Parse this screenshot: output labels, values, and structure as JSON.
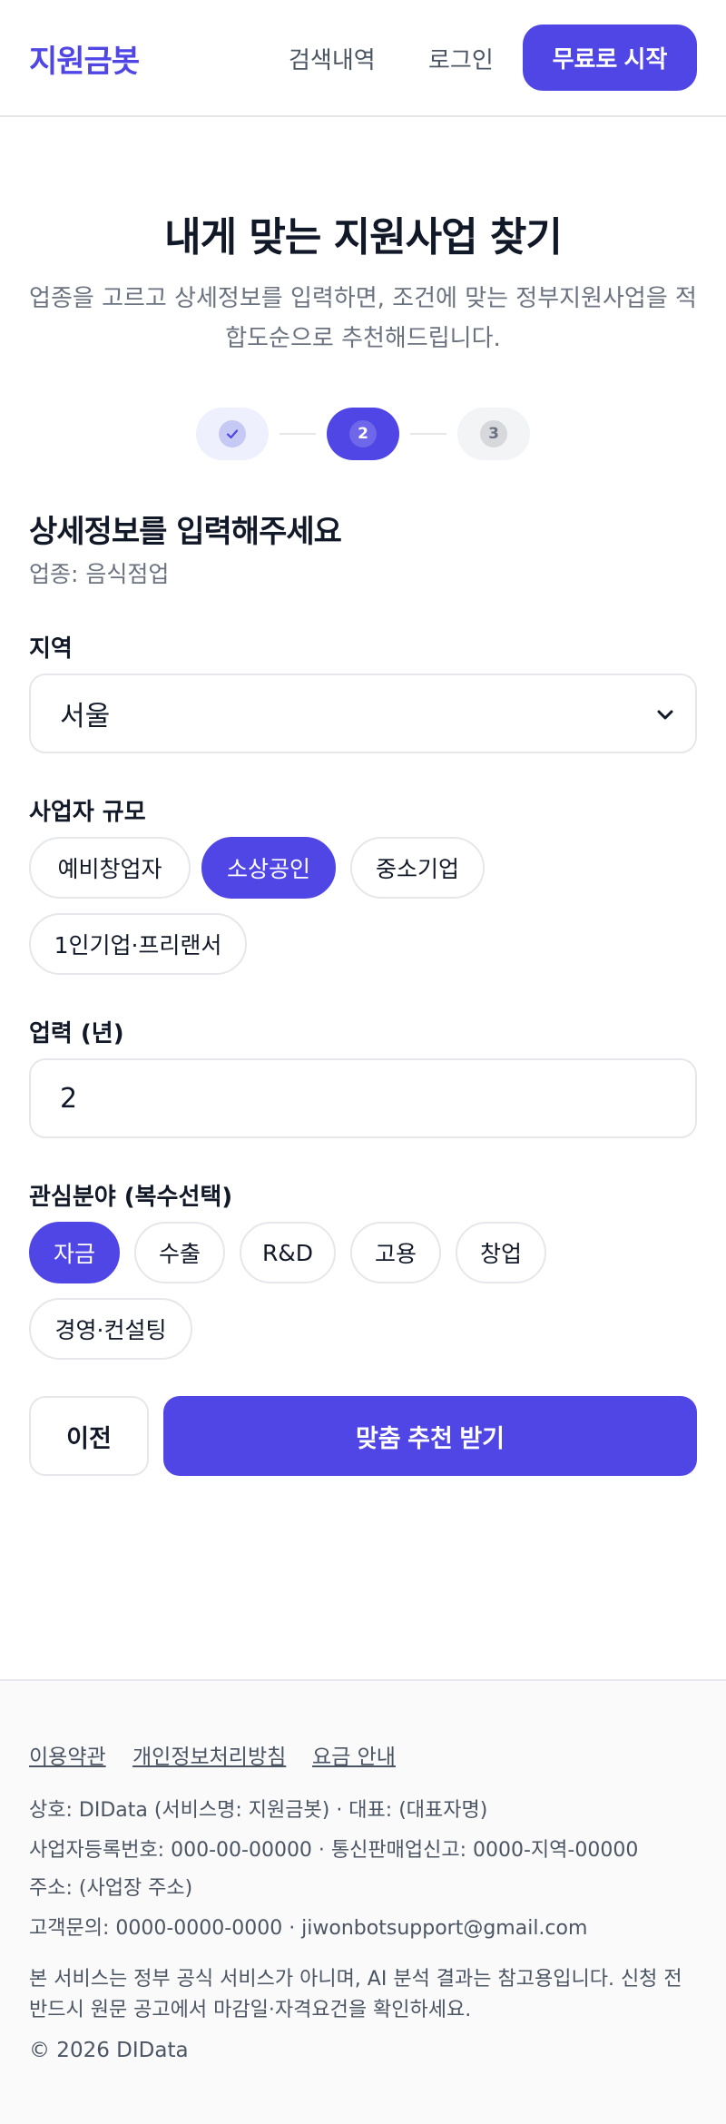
{
  "header": {
    "logo": "지원금봇",
    "nav_history": "검색내역",
    "nav_login": "로그인",
    "cta": "무료로 시작"
  },
  "hero": {
    "title": "내게 맞는 지원사업 찾기",
    "subtitle": "업종을 고르고 상세정보를 입력하면, 조건에 맞는 정부지원사업을 적합도순으로 추천해드립니다."
  },
  "stepper": {
    "current_step": 2,
    "steps": [
      {
        "label": "check-icon",
        "state": "done"
      },
      {
        "label": "2",
        "state": "active"
      },
      {
        "label": "3",
        "state": "pending"
      }
    ]
  },
  "form": {
    "title": "상세정보를 입력해주세요",
    "industry": "업종: 음식점업",
    "region_label": "지역",
    "region_value": "서울",
    "scale_label": "사업자 규모",
    "scale_options": [
      "예비창업자",
      "소상공인",
      "중소기업",
      "1인기업·프리랜서"
    ],
    "scale_selected": "소상공인",
    "years_label": "업력 (년)",
    "years_value": "2",
    "interest_label": "관심분야 (복수선택)",
    "interest_options": [
      "자금",
      "수출",
      "R&D",
      "고용",
      "창업",
      "경영·컨설팅"
    ],
    "interest_selected": [
      "자금"
    ],
    "prev_button": "이전",
    "submit_button": "맞춤 추천 받기"
  },
  "footer": {
    "links": [
      "이용약관",
      "개인정보처리방침",
      "요금 안내"
    ],
    "company": "상호: DIData (서비스명: 지원금봇) · 대표: (대표자명)",
    "registration": "사업자등록번호: 000-00-00000 · 통신판매업신고: 0000-지역-00000",
    "address": "주소: (사업장 주소)",
    "contact": "고객문의: 0000-0000-0000 · jiwonbotsupport@gmail.com",
    "disclaimer": "본 서비스는 정부 공식 서비스가 아니며, AI 분석 결과는 참고용입니다. 신청 전 반드시 원문 공고에서 마감일·자격요건을 확인하세요.",
    "copyright": "© 2026 DIData"
  },
  "colors": {
    "accent": "#4f46e5",
    "border": "#e5e7eb",
    "muted_text": "#6b7280"
  }
}
